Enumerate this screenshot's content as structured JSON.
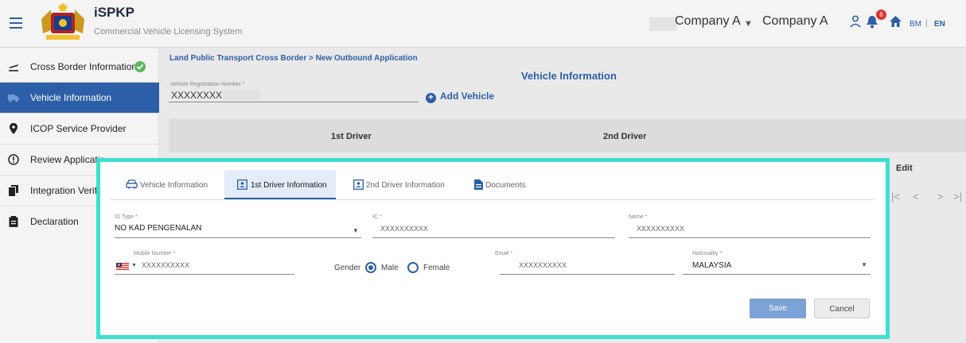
{
  "header": {
    "app_title": "iSPKP",
    "app_subtitle": "Commercial Vehicle Licensing System",
    "company_select": "Company A",
    "company_name": "Company A",
    "notification_count": "6",
    "lang_bm": "BM",
    "lang_sep": "|",
    "lang_en": "EN"
  },
  "sidebar": {
    "items": [
      {
        "label": "Cross Border Information",
        "icon": "airplane-departure-icon",
        "completed": true
      },
      {
        "label": "Vehicle Information",
        "icon": "truck-icon",
        "active": true
      },
      {
        "label": "ICOP Service Provider",
        "icon": "map-pin-icon"
      },
      {
        "label": "Review Applicatio",
        "icon": "alert-circle-icon"
      },
      {
        "label": "Integration Verifi",
        "icon": "file-copy-icon"
      },
      {
        "label": "Declaration",
        "icon": "clipboard-icon"
      }
    ]
  },
  "main": {
    "breadcrumb": "Land Public Transport Cross Border > New Outbound Application",
    "title": "Vehicle Information",
    "vehicle_reg_label": "Vehicle Registration Number *",
    "vehicle_reg_value": "XXXXXXXX",
    "add_vehicle": "Add Vehicle",
    "driver_columns": [
      "1st Driver",
      "2nd Driver"
    ],
    "edit_label": "Edit",
    "pager": [
      "|<",
      "<",
      ">",
      ">|"
    ]
  },
  "modal": {
    "tabs": [
      {
        "label": "Vehicle Information",
        "icon": "car-icon"
      },
      {
        "label": "1st Driver Information",
        "icon": "id-card-icon",
        "active": true
      },
      {
        "label": "2nd Driver Information",
        "icon": "id-card-icon"
      },
      {
        "label": "Documents",
        "icon": "document-icon"
      }
    ],
    "fields": {
      "id_type_label": "ID Type *",
      "id_type_value": "NO KAD PENGENALAN",
      "ic_label": "IC *",
      "ic_value": "XXXXXXXXXX",
      "name_label": "Name *",
      "name_value": "XXXXXXXXXX",
      "mobile_label": "Mobile Number *",
      "mobile_value": "XXXXXXXXXX",
      "gender_label": "Gender",
      "gender_options": [
        "Male",
        "Female"
      ],
      "gender_selected": "Male",
      "email_label": "Email *",
      "email_value": "XXXXXXXXXX",
      "nationality_label": "Nationality *",
      "nationality_value": "MALAYSIA"
    },
    "save_label": "Save",
    "cancel_label": "Cancel"
  },
  "colors": {
    "primary": "#2d5fa8",
    "highlight_border": "#3de0cf",
    "success": "#5cb85c",
    "notification": "#d33333"
  }
}
